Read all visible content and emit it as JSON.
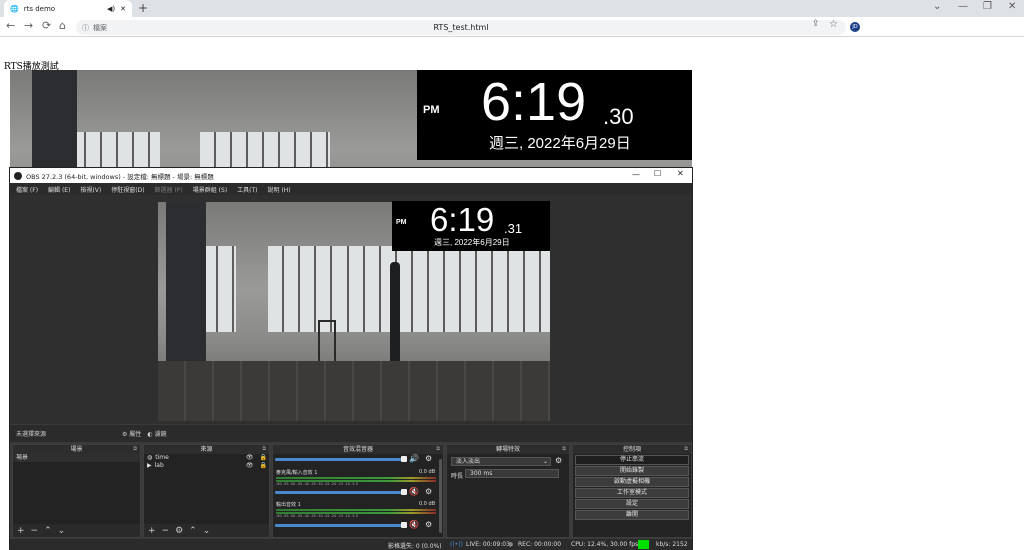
{
  "browser": {
    "tab_title": "rts demo",
    "new_tab": "+",
    "security_label": "檔案",
    "url": "RTS_test.html",
    "profile_initials": "JD"
  },
  "page": {
    "title": "RTS播放測試"
  },
  "clock_big": {
    "ampm": "PM",
    "time": "6:19",
    "seconds": ".30",
    "date": "週三, 2022年6月29日"
  },
  "obs": {
    "title": "OBS 27.2.3 (64-bit, windows) - 設定檔: 無標題 - 場景: 無標題",
    "menu": [
      "檔案 (F)",
      "編輯 (E)",
      "檢視(V)",
      "停駐視窗(D)",
      "篩選器 (P)",
      "場景群組 (S)",
      "工具(T)",
      "說明 (H)"
    ],
    "preview_clock": {
      "ampm": "PM",
      "time": "6:19",
      "seconds": ".31",
      "date": "週三, 2022年6月29日"
    },
    "source_bar": {
      "no_source": "未選擇來源",
      "properties": "屬性",
      "filters": "濾鏡"
    },
    "docks": {
      "scenes": {
        "title": "場景",
        "items": [
          "場景"
        ]
      },
      "sources": {
        "title": "來源",
        "items": [
          "time",
          "lab"
        ]
      },
      "mixer": {
        "title": "音效混音器",
        "channels": [
          {
            "name": "麥克風/輸入音效 1",
            "db": "0.0 dB"
          },
          {
            "name": "輸出音效 1",
            "db": "0.0 dB"
          }
        ],
        "scale": "-60 -55 -50 -45 -40 -35 -30 -25 -20 -15 -10 -5 0"
      },
      "transitions": {
        "title": "轉場特效",
        "selected": "淡入淡出",
        "duration_label": "時長",
        "duration": "300 ms"
      },
      "controls": {
        "title": "控制項",
        "buttons": [
          "停止串流",
          "開始錄製",
          "啟動虛擬相機",
          "工作室模式",
          "設定",
          "離開"
        ]
      }
    },
    "status": {
      "dropped": "影格遺失: 0 (0.0%)",
      "live": "LIVE: 00:09:03",
      "rec": "REC: 00:00:00",
      "cpu": "CPU: 12.4%, 30.00 fps",
      "kbps": "kb/s: 2152",
      "live_indicator_color": "#00e000"
    }
  }
}
